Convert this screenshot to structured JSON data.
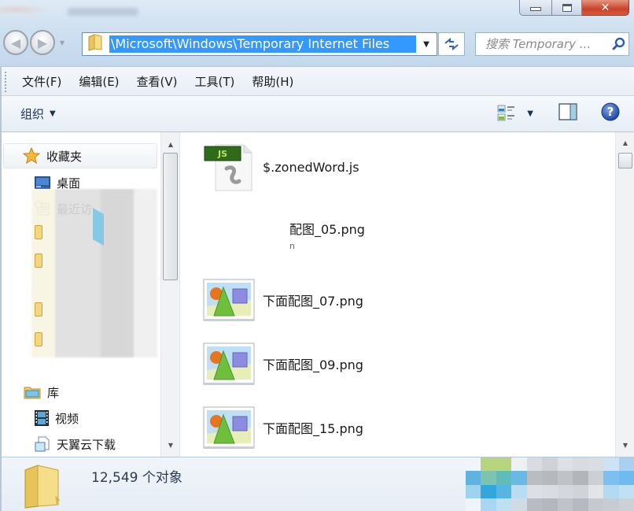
{
  "window": {
    "caption_buttons": {
      "minimize": "minimize",
      "maximize": "maximize",
      "close": "✕"
    }
  },
  "navigation": {
    "back_icon": "back-arrow-icon",
    "forward_icon": "forward-arrow-icon",
    "recent_dropdown_icon": "chevron-down-icon"
  },
  "address_bar": {
    "path": "\\Microsoft\\Windows\\Temporary Internet Files",
    "selected": true
  },
  "search": {
    "placeholder": "搜索 Temporary ...",
    "value": ""
  },
  "menu": {
    "items": [
      {
        "label": "文件(F)"
      },
      {
        "label": "编辑(E)"
      },
      {
        "label": "查看(V)"
      },
      {
        "label": "工具(T)"
      },
      {
        "label": "帮助(H)"
      }
    ]
  },
  "command_bar": {
    "organize_label": "组织",
    "view_icon": "change-view-icon",
    "preview_icon": "preview-pane-icon",
    "help_icon": "help-icon"
  },
  "nav_pane": {
    "favorites": {
      "label": "收藏夹",
      "items": [
        {
          "label": "桌面",
          "icon": "desktop-icon"
        },
        {
          "label": "最近访",
          "icon": "recent-places-icon"
        }
      ]
    },
    "libraries": {
      "label": "库",
      "items": [
        {
          "label": "视频",
          "icon": "video-library-icon"
        },
        {
          "label": "天翼云下载",
          "icon": "document-folder-icon"
        }
      ]
    }
  },
  "files": [
    {
      "name": "$.zonedWord.js",
      "type": "js",
      "badge": "JS"
    },
    {
      "name": "配图_05.png",
      "type": "png-partial",
      "sub": "n"
    },
    {
      "name": "下面配图_07.png",
      "type": "image"
    },
    {
      "name": "下面配图_09.png",
      "type": "image"
    },
    {
      "name": "下面配图_15.png",
      "type": "image"
    }
  ],
  "status_bar": {
    "item_count": "12,549 个对象"
  },
  "colors": {
    "selection": "#3399ff",
    "chrome": "#cfe0f0",
    "close_button": "#c8432a",
    "js_badge": "#2f6b1a"
  }
}
